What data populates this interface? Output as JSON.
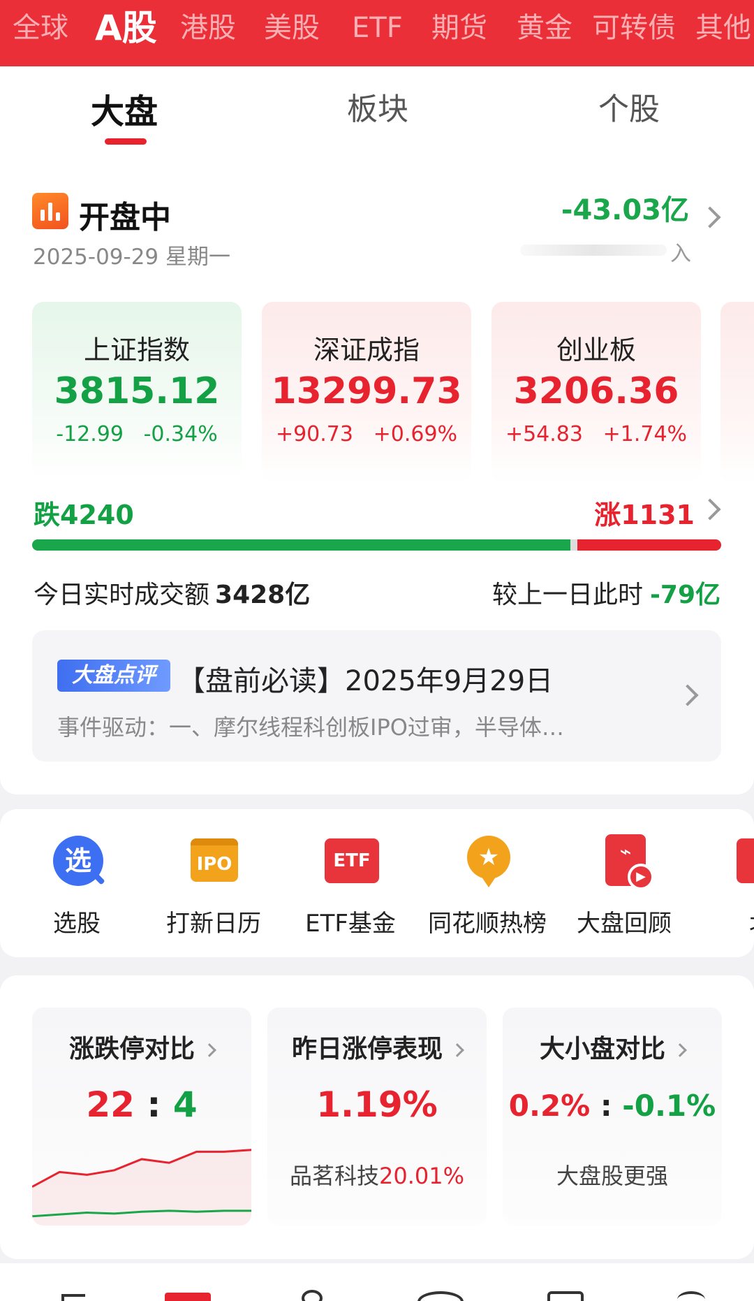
{
  "market_tabs": [
    "全球",
    "A股",
    "港股",
    "美股",
    "ETF",
    "期货",
    "黄金",
    "可转债",
    "其他"
  ],
  "market_active": "A股",
  "sub_tabs": [
    "大盘",
    "板块",
    "个股"
  ],
  "status": {
    "title": "开盘中",
    "date": "2025-09-29 星期一",
    "net_flow": "-43.03亿",
    "net_flow_tail": "入"
  },
  "indices": [
    {
      "name": "上证指数",
      "value": "3815.12",
      "change": "-12.99",
      "pct": "-0.34%",
      "dir": "down"
    },
    {
      "name": "深证成指",
      "value": "13299.73",
      "change": "+90.73",
      "pct": "+0.69%",
      "dir": "up"
    },
    {
      "name": "创业板",
      "value": "3206.36",
      "change": "+54.83",
      "pct": "+1.74%",
      "dir": "up"
    }
  ],
  "breadth": {
    "fall_label": "跌4240",
    "rise_label": "涨1131",
    "fall": 4240,
    "rise": 1131
  },
  "turnover": {
    "label": "今日实时成交额",
    "value": "3428亿",
    "compare_label": "较上一日此时",
    "compare_value": "-79亿"
  },
  "commentary": {
    "badge": "大盘点评",
    "title": "【盘前必读】2025年9月29日",
    "snippet": "事件驱动：一、摩尔线程科创板IPO过审，半导体…"
  },
  "shortcuts": [
    {
      "label": "选股",
      "icon": "pick-stock-icon",
      "glyph": "选"
    },
    {
      "label": "打新日历",
      "icon": "ipo-calendar-icon",
      "glyph": "IPO"
    },
    {
      "label": "ETF基金",
      "icon": "etf-icon",
      "glyph": "ETF"
    },
    {
      "label": "同花顺热榜",
      "icon": "hot-list-icon",
      "glyph": "★"
    },
    {
      "label": "大盘回顾",
      "icon": "market-review-icon",
      "glyph": "⌁"
    },
    {
      "label": "北",
      "icon": "northbound-icon",
      "glyph": ""
    }
  ],
  "stats": [
    {
      "title": "涨跌停对比",
      "main_left": "22",
      "main_sep": ":",
      "main_right": "4",
      "sub": ""
    },
    {
      "title": "昨日涨停表现",
      "main": "1.19%",
      "sub_name": "品茗科技",
      "sub_value": "20.01%"
    },
    {
      "title": "大小盘对比",
      "main_left": "0.2%",
      "main_sep": ":",
      "main_right": "-0.1%",
      "sub": "大盘股更强"
    }
  ],
  "limit_chart": {
    "up_series": [
      0.42,
      0.58,
      0.55,
      0.6,
      0.72,
      0.68,
      0.8,
      0.8,
      0.82
    ],
    "down_series": [
      0.1,
      0.12,
      0.14,
      0.13,
      0.15,
      0.16,
      0.15,
      0.16,
      0.16
    ]
  },
  "colors": {
    "brand_red": "#ea2f38",
    "up_red": "#e6232e",
    "down_green": "#14a045",
    "badge_blue": "#3f6ef0"
  }
}
